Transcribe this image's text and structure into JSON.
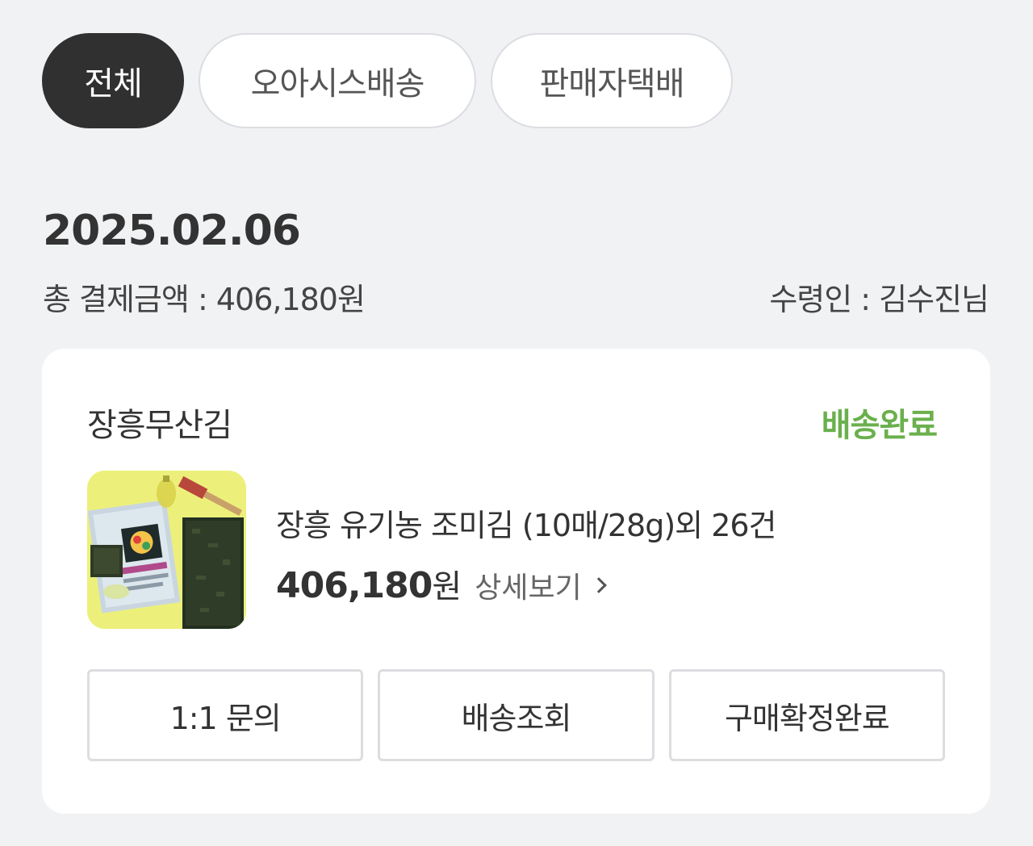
{
  "filters": {
    "tabs": [
      {
        "label": "전체",
        "active": true
      },
      {
        "label": "오아시스배송",
        "active": false
      },
      {
        "label": "판매자택배",
        "active": false
      }
    ]
  },
  "order": {
    "date": "2025.02.06",
    "total_label": "총 결제금액 : 406,180원",
    "recipient_label": "수령인 : 김수진님"
  },
  "card": {
    "seller_name": "장흥무산김",
    "status": "배송완료",
    "status_color": "#6ab04c",
    "product_name": "장흥 유기농 조미김 (10매/28g)외 26건",
    "price_value": "406,180",
    "price_unit": "원",
    "detail_label": "상세보기",
    "detail_icon": "chevron-right-icon",
    "actions": [
      {
        "label": "1:1 문의"
      },
      {
        "label": "배송조회"
      },
      {
        "label": "구매확정완료"
      }
    ]
  }
}
